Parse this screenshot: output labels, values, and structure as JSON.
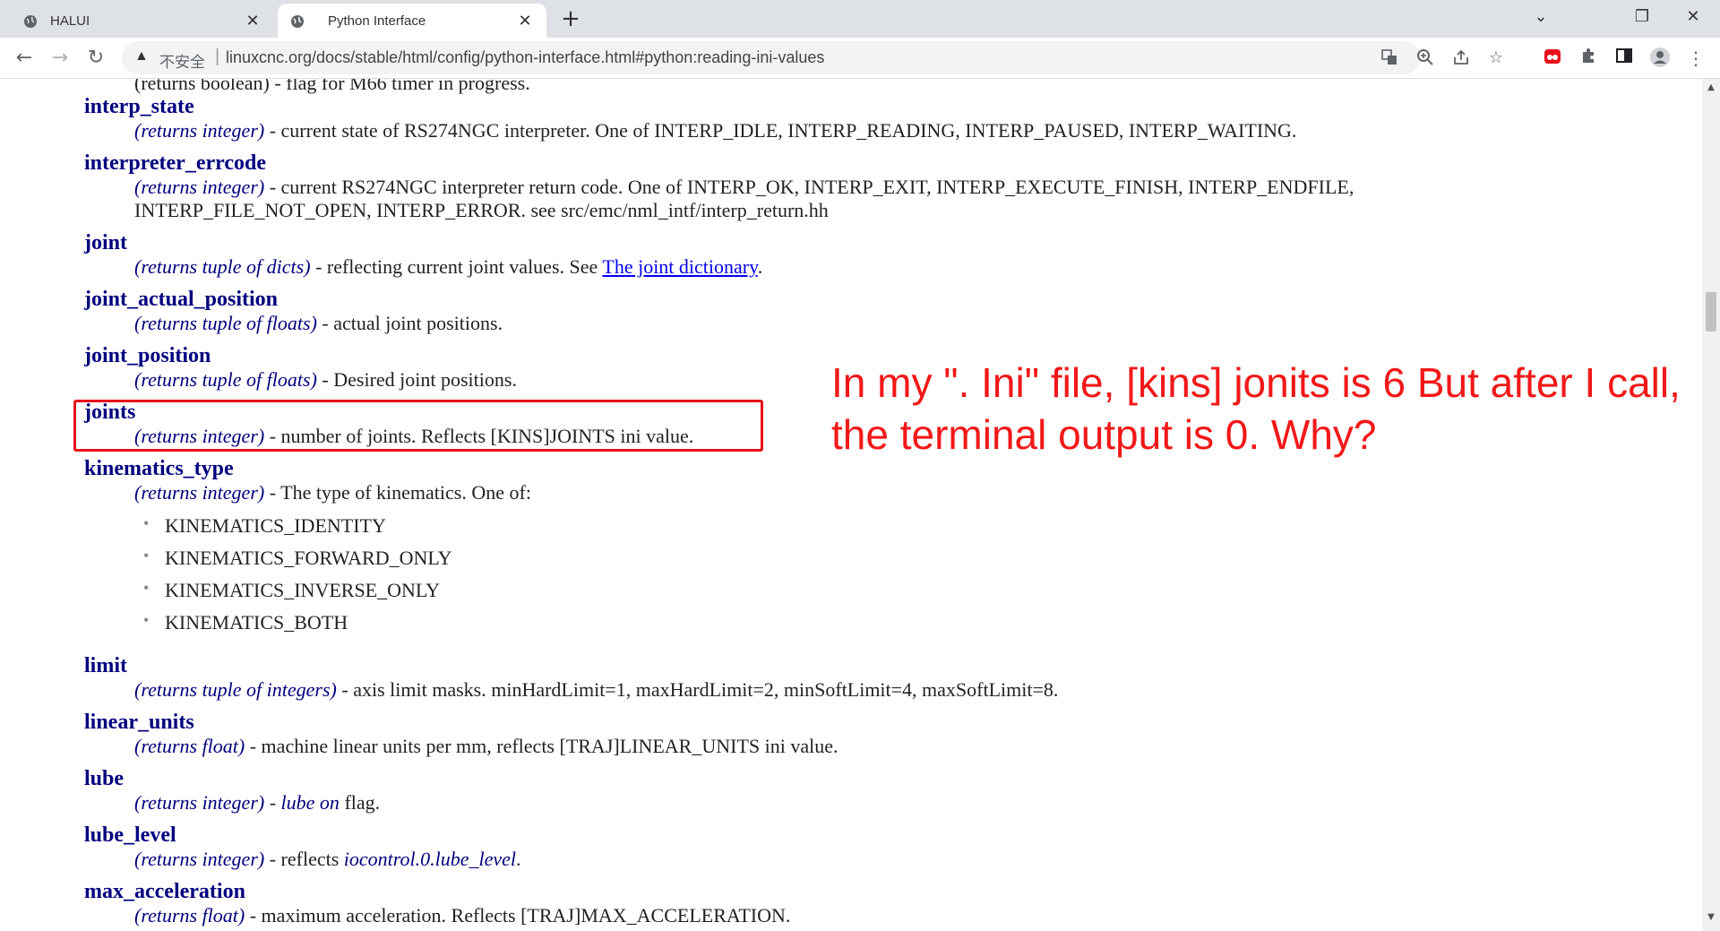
{
  "tabs": [
    {
      "label": "HALUI",
      "close": "✕"
    },
    {
      "label": "Python Interface",
      "close": "✕"
    }
  ],
  "new_tab": "+",
  "window_controls": {
    "minimize": "⌄",
    "restore": "❐",
    "close": "✕"
  },
  "toolbar": {
    "back": "←",
    "forward": "→",
    "reload": "↻"
  },
  "omnibox": {
    "warning": "▲",
    "insecure_label": "不安全",
    "separator": "|",
    "url": "linuxcnc.org/docs/stable/html/config/python-interface.html#python:reading-ini-values"
  },
  "entries": [
    {
      "term": "interp_state",
      "returns": "(returns integer)",
      "desc": " - current state of RS274NGC interpreter. One of INTERP_IDLE, INTERP_READING, INTERP_PAUSED, INTERP_WAITING."
    },
    {
      "term": "interpreter_errcode",
      "returns": "(returns integer)",
      "desc": " - current RS274NGC interpreter return code. One of INTERP_OK, INTERP_EXIT, INTERP_EXECUTE_FINISH, INTERP_ENDFILE,",
      "desc2": "INTERP_FILE_NOT_OPEN, INTERP_ERROR. see src/emc/nml_intf/interp_return.hh"
    },
    {
      "term": "joint",
      "returns": "(returns tuple of dicts)",
      "desc": " - reflecting current joint values. See ",
      "link": "The joint dictionary",
      "after": "."
    },
    {
      "term": "joint_actual_position",
      "returns": "(returns tuple of floats)",
      "desc": " - actual joint positions."
    },
    {
      "term": "joint_position",
      "returns": "(returns tuple of floats)",
      "desc": " - Desired joint positions."
    },
    {
      "term": "joints",
      "returns": "(returns integer)",
      "desc": " - number of joints. Reflects [KINS]JOINTS ini value."
    },
    {
      "term": "kinematics_type",
      "returns": "(returns integer)",
      "desc": " - The type of kinematics. One of:"
    },
    {
      "term": "limit",
      "returns": "(returns tuple of integers)",
      "desc": " - axis limit masks. minHardLimit=1, maxHardLimit=2, minSoftLimit=4, maxSoftLimit=8."
    },
    {
      "term": "linear_units",
      "returns": "(returns float)",
      "desc": " - machine linear units per mm, reflects [TRAJ]LINEAR_UNITS ini value."
    },
    {
      "term": "lube",
      "returns": "(returns integer)",
      "desc": " - ",
      "em2": "lube on",
      "after": " flag."
    },
    {
      "term": "lube_level",
      "returns": "(returns integer)",
      "desc": " - reflects ",
      "em2": "iocontrol.0.lube_level",
      "after": "."
    },
    {
      "term": "max_acceleration",
      "returns": "(returns float)",
      "desc": " - maximum acceleration. Reflects [TRAJ]MAX_ACCELERATION."
    }
  ],
  "cutoff_line": "(returns boolean) - flag for M66 timer in progress.",
  "kinematics_options": [
    "KINEMATICS_IDENTITY",
    "KINEMATICS_FORWARD_ONLY",
    "KINEMATICS_INVERSE_ONLY",
    "KINEMATICS_BOTH"
  ],
  "annotation": {
    "line1": "In my \". Ini\" file, [kins] jonits is 6 But after I call,",
    "line2": "the terminal output is 0. Why?",
    "color": "#f21818"
  },
  "colors": {
    "term": "#00007f",
    "link": "#0000ee",
    "highlight": "#e8101a"
  }
}
